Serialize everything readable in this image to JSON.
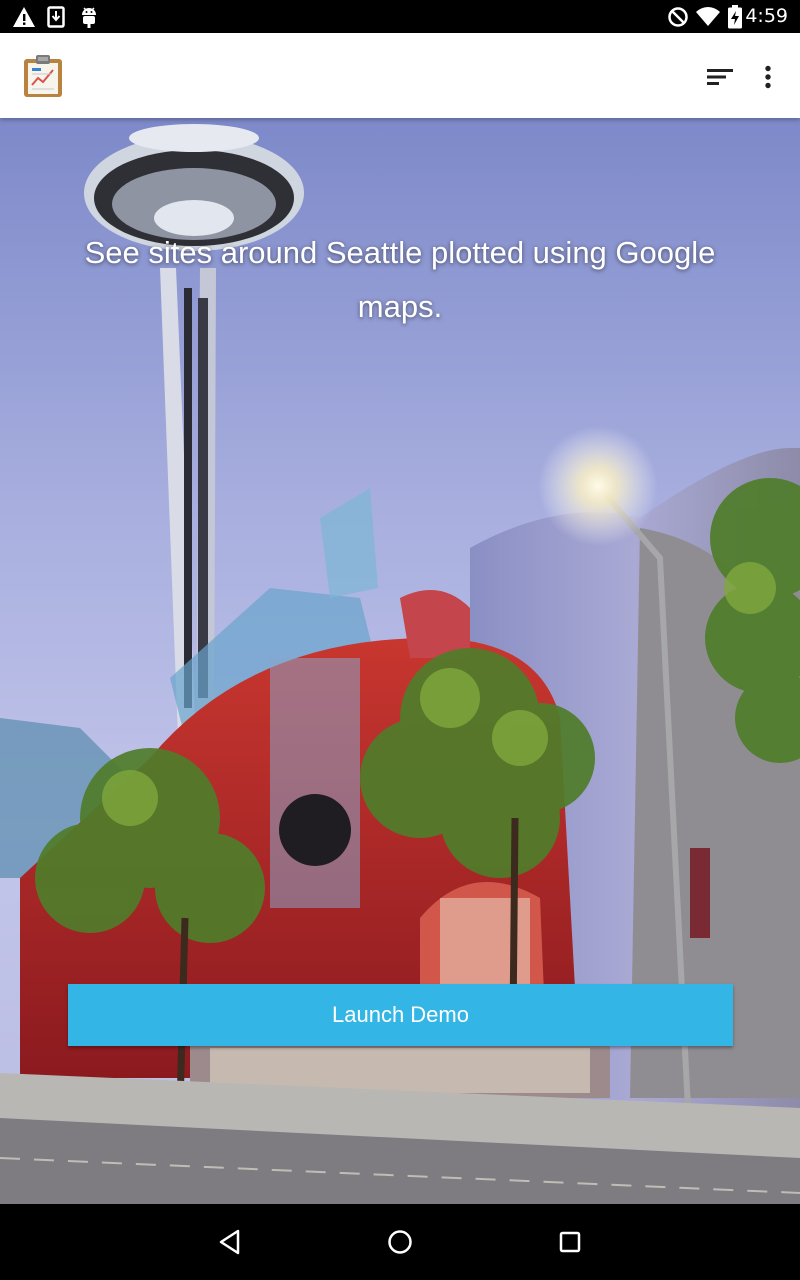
{
  "status_bar": {
    "time": "4:59",
    "icons": [
      "warning-icon",
      "download-icon",
      "android-debug-icon",
      "do-not-disturb-icon",
      "wifi-icon",
      "battery-charging-icon"
    ]
  },
  "app_bar": {
    "icons": [
      "clipboard-chart-app-icon",
      "sort-icon",
      "more-vert-icon"
    ]
  },
  "hero": {
    "description": "See sites around Seattle plotted using Google maps.",
    "launch_button_label": "Launch Demo",
    "button_color": "#33b5e5"
  },
  "nav_bar": {
    "icons": [
      "back-icon",
      "home-icon",
      "recents-icon"
    ]
  }
}
